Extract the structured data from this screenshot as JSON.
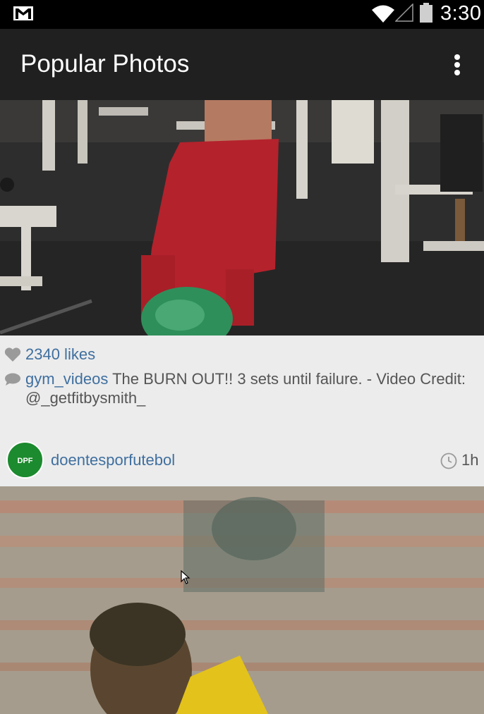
{
  "status_bar": {
    "time": "3:30",
    "icons": [
      "gmail-icon",
      "wifi-icon",
      "signal-icon",
      "battery-icon"
    ]
  },
  "action_bar": {
    "title": "Popular Photos",
    "overflow_icon": "overflow-menu-icon"
  },
  "posts": [
    {
      "media_description_icon": "gym-video-image",
      "likes": "2340 likes",
      "caption_user": "gym_videos",
      "caption_text": " The BURN OUT!! 3 sets until failure. - Video Credit: @_getfitbysmith_"
    },
    {
      "author": "doentesporfutebol",
      "avatar_text": "DPF",
      "time_ago": "1h",
      "media_description_icon": "soccer-video-image"
    }
  ],
  "colors": {
    "status_bar_bg": "#000000",
    "action_bar_bg": "#202020",
    "link_blue": "#3f6f9f",
    "body_bg": "#ececec",
    "avatar_green": "#1c8a2e"
  }
}
